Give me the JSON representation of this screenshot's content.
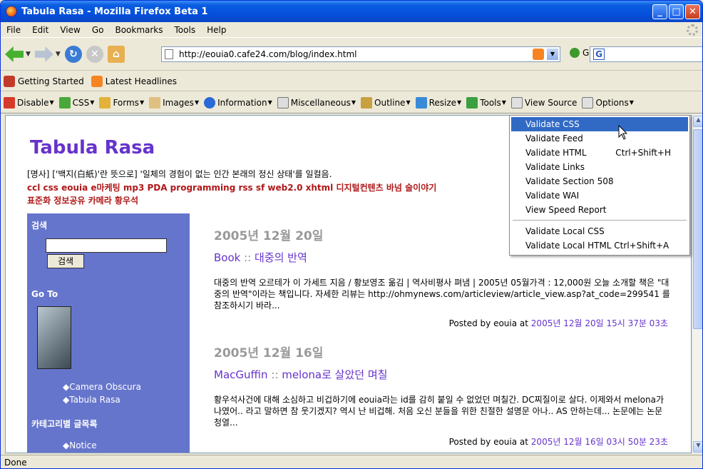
{
  "window": {
    "title": "Tabula Rasa - Mozilla Firefox Beta 1"
  },
  "menubar": [
    "File",
    "Edit",
    "View",
    "Go",
    "Bookmarks",
    "Tools",
    "Help"
  ],
  "nav": {
    "url": "http://eouia0.cafe24.com/blog/index.html",
    "go_label": "Go"
  },
  "bookmarks": [
    {
      "label": "Getting Started"
    },
    {
      "label": "Latest Headlines"
    }
  ],
  "webdev_toolbar": [
    "Disable",
    "CSS",
    "Forms",
    "Images",
    "Information",
    "Miscellaneous",
    "Outline",
    "Resize",
    "Tools",
    "View Source",
    "Options"
  ],
  "tools_menu": {
    "items": [
      {
        "label": "Validate CSS",
        "shortcut": ""
      },
      {
        "label": "Validate Feed",
        "shortcut": ""
      },
      {
        "label": "Validate HTML",
        "shortcut": "Ctrl+Shift+H"
      },
      {
        "label": "Validate Links",
        "shortcut": ""
      },
      {
        "label": "Validate Section 508",
        "shortcut": ""
      },
      {
        "label": "Validate WAI",
        "shortcut": ""
      },
      {
        "label": "View Speed Report",
        "shortcut": ""
      },
      {
        "label": "Validate Local CSS",
        "shortcut": ""
      },
      {
        "label": "Validate Local HTML Ctrl+Shift+A",
        "shortcut": ""
      }
    ],
    "selected_index": 0
  },
  "blog": {
    "title": "Tabula Rasa",
    "description": "[명사] ['백지(白紙)'란 뜻으로] '일체의 경험이 없는 인간 본래의 정신 상태'를 일컬음.",
    "tags_line1": "ccl css eouia e마케팅 mp3 PDA programming rss sf web2.0 xhtml 디지털컨텐츠 바넘 술이야기",
    "tags_line2": "표준화 정보공유 카메라 황우석"
  },
  "sidebar": {
    "search_heading": "검색",
    "search_button": "검색",
    "goto_heading": "Go To",
    "links": [
      "Camera Obscura",
      "Tabula Rasa"
    ],
    "category_heading": "카테고리별 글목록",
    "category_links": [
      "Notice"
    ]
  },
  "posts": [
    {
      "date": "2005년 12월 20일",
      "category": "Book",
      "separator": "::",
      "title": "대중의 반역",
      "body": "대중의 반역 오르테가 이 가세트 지음 / 황보영조 옮김 | 역사비평사 펴냄 | 2005년 05월가격 : 12,000원 오늘 소개할 책은 \"대중의 반역\"이라는 책입니다. 자세한 리뷰는 http://ohmynews.com/articleview/article_view.asp?at_code=299541 를 참조하시기 바라...",
      "posted_by": "Posted by eouia at",
      "timestamp": "2005년 12월 20일 15시 37분 03초"
    },
    {
      "date": "2005년 12월 16일",
      "category": "MacGuffin",
      "separator": "::",
      "title": "melona로 살았던 며칠",
      "body": "황우석사건에 대해 소심하고 비겁하기에 eouia라는 id를 감히 붙일 수 없었던 며칠간. DC찌질이로 살다. 이제와서 melona가 나였어.. 라고 말하면 참 웃기겠지? 역시 난 비겁해. 처음 오신 분들을 위한 친절한 설명문 아나.. AS 안하는데... 논문에는 논문 청열...",
      "posted_by": "Posted by eouia at",
      "timestamp": "2005년 12월 16일 03시 50분 23초"
    }
  ],
  "status": "Done"
}
